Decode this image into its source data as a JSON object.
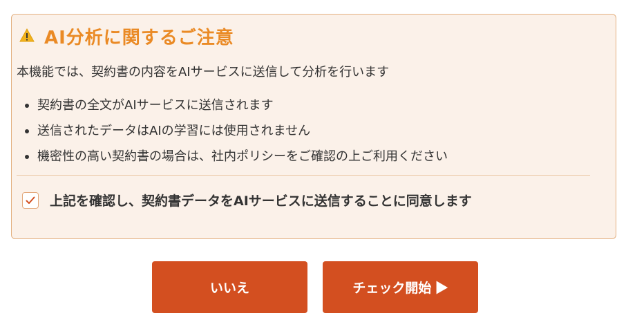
{
  "notice": {
    "title": "AI分析に関するご注意",
    "description": "本機能では、契約書の内容をAIサービスに送信して分析を行います",
    "bullets": [
      "契約書の全文がAIサービスに送信されます",
      "送信されたデータはAIの学習には使用されません",
      "機密性の高い契約書の場合は、社内ポリシーをご確認の上ご利用ください"
    ],
    "consent_label": "上記を確認し、契約書データをAIサービスに送信することに同意します",
    "consent_checked": true,
    "warning_icon": "warning-triangle-icon",
    "accent_color": "#ea8a25"
  },
  "actions": {
    "no_label": "いいえ",
    "start_label": "チェック開始 ▶",
    "button_color": "#d34f20"
  }
}
